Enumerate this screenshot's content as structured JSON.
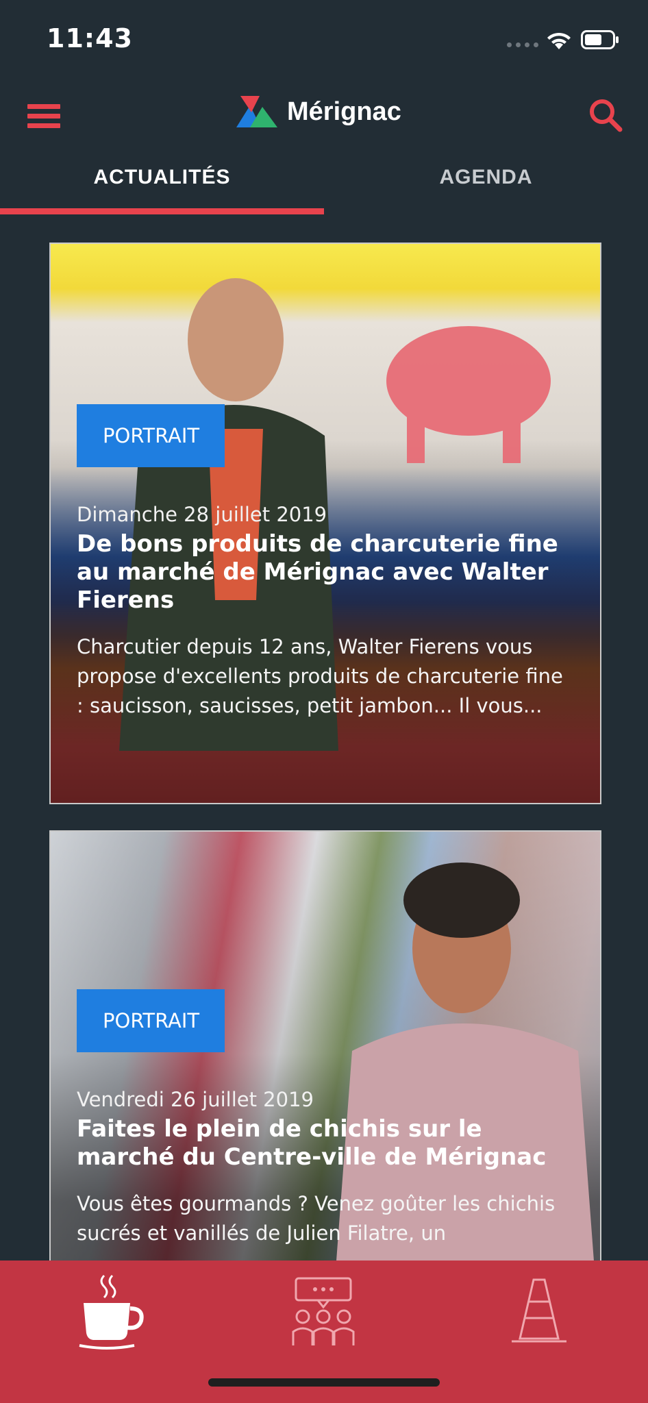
{
  "status_bar": {
    "time": "11:43"
  },
  "header": {
    "app_name": "Mérignac"
  },
  "tabs": [
    {
      "label": "ACTUALITÉS",
      "active": true
    },
    {
      "label": "AGENDA",
      "active": false
    }
  ],
  "articles": [
    {
      "category": "PORTRAIT",
      "date": "Dimanche 28 juillet 2019",
      "title": "De bons produits de charcuterie fine au marché de Mérignac avec Walter Fierens",
      "excerpt": "Charcutier depuis 12 ans, Walter Fierens vous propose d'excellents produits de charcuterie fine : saucisson, saucisses, petit jambon... Il vous..."
    },
    {
      "category": "PORTRAIT",
      "date": "Vendredi 26 juillet 2019",
      "title": "Faites le plein de chichis sur le marché du Centre-ville de Mérignac",
      "excerpt": "Vous êtes gourmands ? Venez goûter les chichis sucrés et vanillés de Julien Filatre, un"
    }
  ],
  "bottom_nav": [
    {
      "icon": "coffee-cup-icon",
      "active": true
    },
    {
      "icon": "community-icon",
      "active": false
    },
    {
      "icon": "traffic-cone-icon",
      "active": false
    }
  ],
  "colors": {
    "background": "#222d35",
    "accent": "#e8434d",
    "badge": "#1f7ee0",
    "nav_bar": "#c23543"
  }
}
